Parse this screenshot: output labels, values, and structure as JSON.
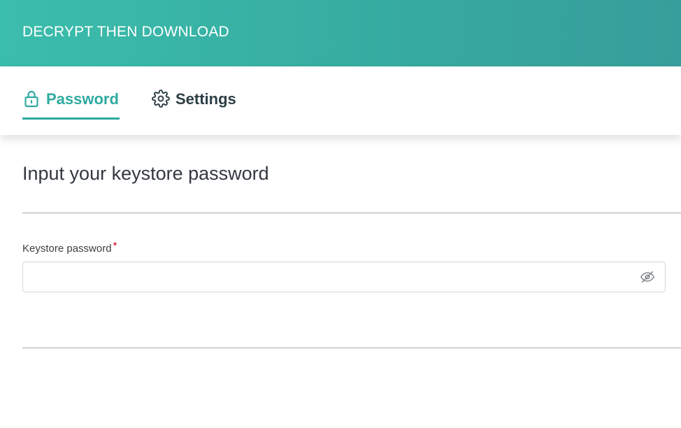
{
  "header": {
    "title": "DECRYPT THEN DOWNLOAD"
  },
  "tabs": [
    {
      "label": "Password",
      "icon": "lock-icon",
      "active": true
    },
    {
      "label": "Settings",
      "icon": "gear-icon",
      "active": false
    }
  ],
  "main": {
    "section_title": "Input your keystore password",
    "field": {
      "label": "Keystore password",
      "required_marker": "*",
      "value": "",
      "placeholder": "",
      "toggle_icon": "eye-slash-icon"
    }
  },
  "colors": {
    "accent": "#2faaa0",
    "header_start": "#3bbdac",
    "header_end": "#389e9b",
    "required": "#d0021b"
  }
}
